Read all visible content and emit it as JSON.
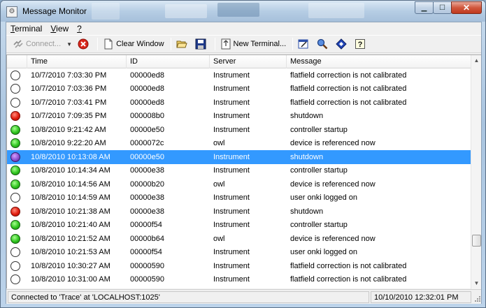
{
  "window": {
    "title": "Message Monitor"
  },
  "menu": [
    {
      "label": "Terminal",
      "underline": "T",
      "rest": "erminal"
    },
    {
      "label": "View",
      "underline": "V",
      "rest": "iew"
    },
    {
      "label": "?",
      "underline": "?",
      "rest": ""
    }
  ],
  "toolbar": {
    "connect_label": "Connect...",
    "clear_label": "Clear Window",
    "new_terminal_label": "New Terminal..."
  },
  "table": {
    "columns": [
      "Time",
      "ID",
      "Server",
      "Message"
    ],
    "rows": [
      {
        "status": "empty",
        "time": "10/7/2010 7:03:30 PM",
        "id": "00000ed8",
        "server": "Instrument",
        "message": "flatfield correction is not calibrated"
      },
      {
        "status": "empty",
        "time": "10/7/2010 7:03:36 PM",
        "id": "00000ed8",
        "server": "Instrument",
        "message": "flatfield correction is not calibrated"
      },
      {
        "status": "empty",
        "time": "10/7/2010 7:03:41 PM",
        "id": "00000ed8",
        "server": "Instrument",
        "message": "flatfield correction is not calibrated"
      },
      {
        "status": "red",
        "time": "10/7/2010 7:09:35 PM",
        "id": "000008b0",
        "server": "Instrument",
        "message": "shutdown"
      },
      {
        "status": "green",
        "time": "10/8/2010 9:21:42 AM",
        "id": "00000e50",
        "server": "Instrument",
        "message": "controller startup"
      },
      {
        "status": "green",
        "time": "10/8/2010 9:22:20 AM",
        "id": "0000072c",
        "server": "owl",
        "message": "device is referenced now"
      },
      {
        "status": "violet",
        "time": "10/8/2010 10:13:08 AM",
        "id": "00000e50",
        "server": "Instrument",
        "message": "shutdown",
        "selected": true
      },
      {
        "status": "green",
        "time": "10/8/2010 10:14:34 AM",
        "id": "00000e38",
        "server": "Instrument",
        "message": "controller startup"
      },
      {
        "status": "green",
        "time": "10/8/2010 10:14:56 AM",
        "id": "00000b20",
        "server": "owl",
        "message": "device is referenced now"
      },
      {
        "status": "empty",
        "time": "10/8/2010 10:14:59 AM",
        "id": "00000e38",
        "server": "Instrument",
        "message": "user onki logged on"
      },
      {
        "status": "red",
        "time": "10/8/2010 10:21:38 AM",
        "id": "00000e38",
        "server": "Instrument",
        "message": "shutdown"
      },
      {
        "status": "green",
        "time": "10/8/2010 10:21:40 AM",
        "id": "00000f54",
        "server": "Instrument",
        "message": "controller startup"
      },
      {
        "status": "green",
        "time": "10/8/2010 10:21:52 AM",
        "id": "00000b64",
        "server": "owl",
        "message": "device is referenced now"
      },
      {
        "status": "empty",
        "time": "10/8/2010 10:21:53 AM",
        "id": "00000f54",
        "server": "Instrument",
        "message": "user onki logged on"
      },
      {
        "status": "empty",
        "time": "10/8/2010 10:30:27 AM",
        "id": "00000590",
        "server": "Instrument",
        "message": "flatfield correction is not calibrated"
      },
      {
        "status": "empty",
        "time": "10/8/2010 10:31:00 AM",
        "id": "00000590",
        "server": "Instrument",
        "message": "flatfield correction is not calibrated"
      }
    ]
  },
  "statusbar": {
    "connection": "Connected to 'Trace' at 'LOCALHOST:1025'",
    "datetime": "10/10/2010  12:32:01 PM"
  }
}
